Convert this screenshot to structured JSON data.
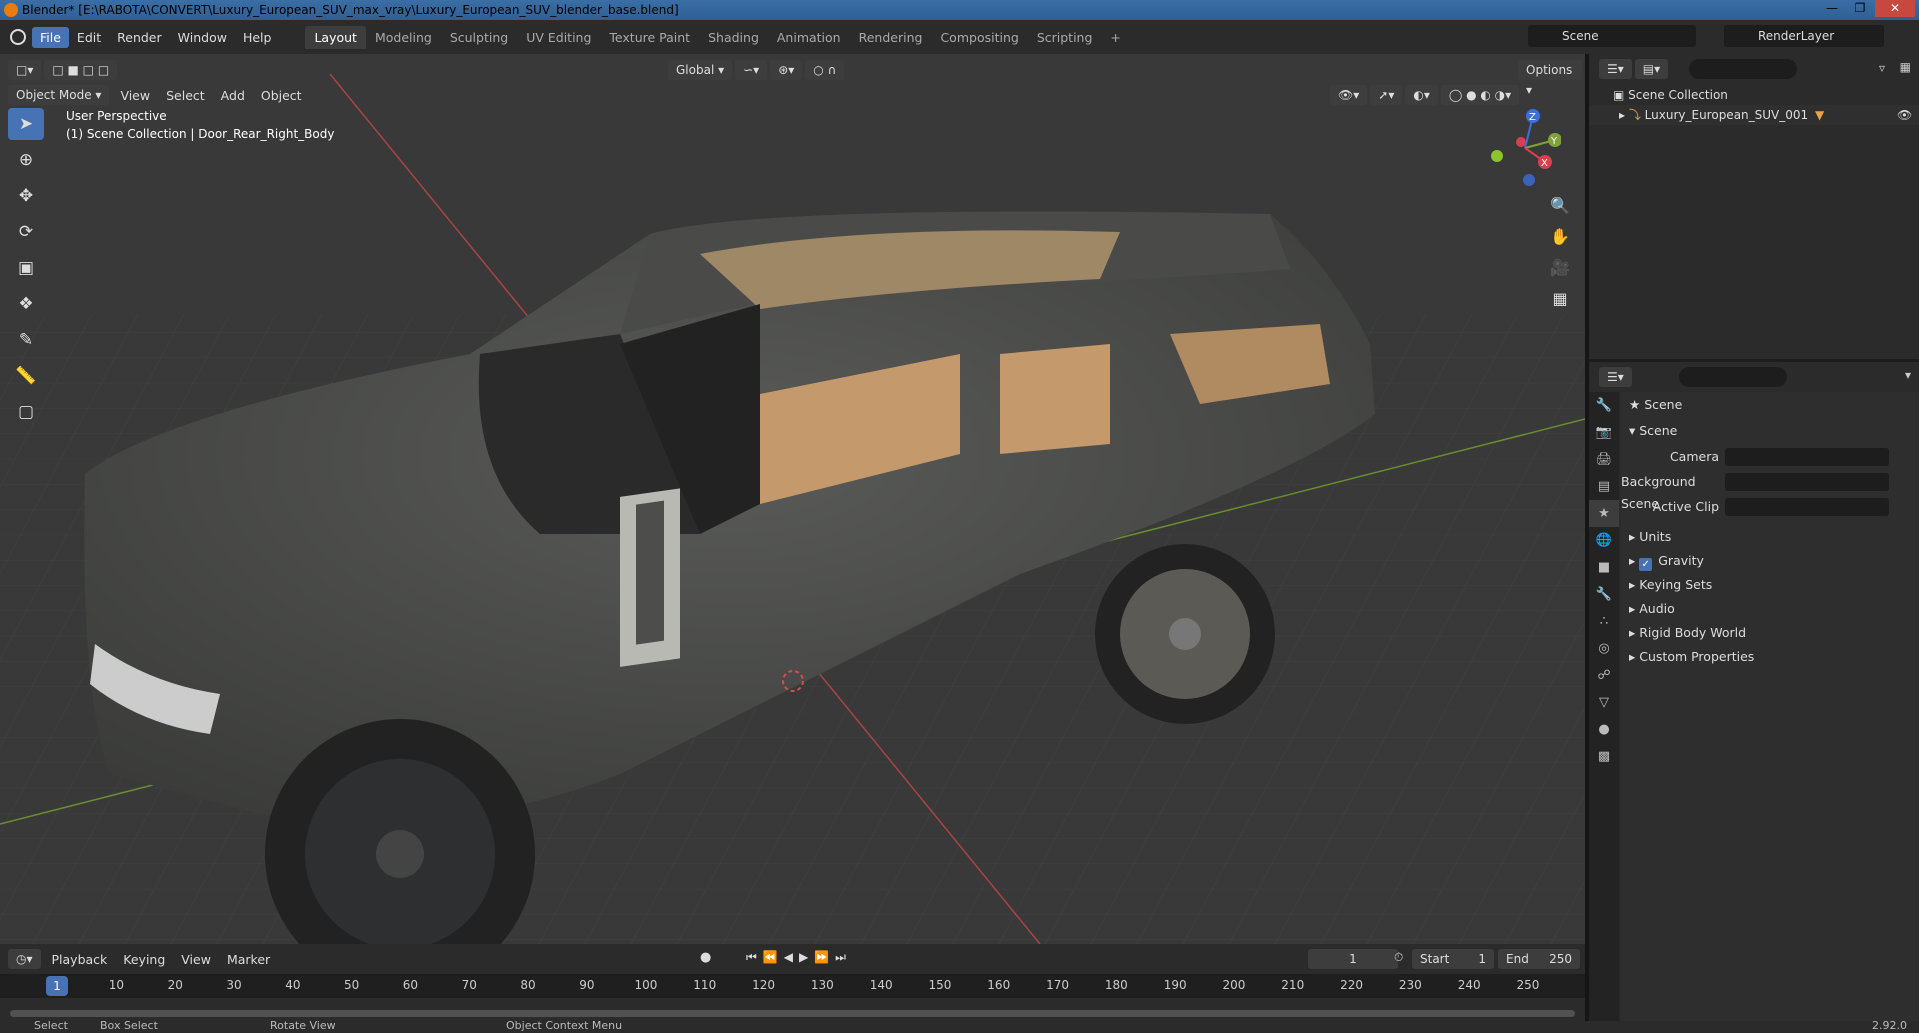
{
  "window": {
    "title": "Blender* [E:\\RABOTA\\CONVERT\\Luxury_European_SUV_max_vray\\Luxury_European_SUV_blender_base.blend]"
  },
  "menu": [
    "File",
    "Edit",
    "Render",
    "Window",
    "Help"
  ],
  "workspaces": [
    "Layout",
    "Modeling",
    "Sculpting",
    "UV Editing",
    "Texture Paint",
    "Shading",
    "Animation",
    "Rendering",
    "Compositing",
    "Scripting"
  ],
  "scene_name": "Scene",
  "render_layer": "RenderLayer",
  "viewport": {
    "mode": "Object Mode",
    "menus": [
      "View",
      "Select",
      "Add",
      "Object"
    ],
    "orientation": "Global",
    "options": "Options",
    "info_line1": "User Perspective",
    "info_line2": "(1) Scene Collection | Door_Rear_Right_Body"
  },
  "outliner": {
    "collection": "Scene Collection",
    "object": "Luxury_European_SUV_001"
  },
  "properties": {
    "header": "Scene",
    "panel": "Scene",
    "camera_label": "Camera",
    "bg_scene_label": "Background Scene",
    "active_clip_label": "Active Clip",
    "sections": [
      "Units",
      "Gravity",
      "Keying Sets",
      "Audio",
      "Rigid Body World",
      "Custom Properties"
    ]
  },
  "timeline": {
    "menus": [
      "Playback",
      "Keying",
      "View",
      "Marker"
    ],
    "current_frame": "1",
    "start_label": "Start",
    "start": "1",
    "end_label": "End",
    "end": "250",
    "ticks": [
      "1",
      "10",
      "20",
      "30",
      "40",
      "50",
      "60",
      "70",
      "80",
      "90",
      "100",
      "110",
      "120",
      "130",
      "140",
      "150",
      "160",
      "170",
      "180",
      "190",
      "200",
      "210",
      "220",
      "230",
      "240",
      "250"
    ]
  },
  "status": {
    "select": "Select",
    "box_select": "Box Select",
    "rotate": "Rotate View",
    "context": "Object Context Menu",
    "version": "2.92.0"
  },
  "colors": {
    "accent": "#4772b3",
    "car": "#4d4e4c",
    "interior": "#c49a6c"
  }
}
